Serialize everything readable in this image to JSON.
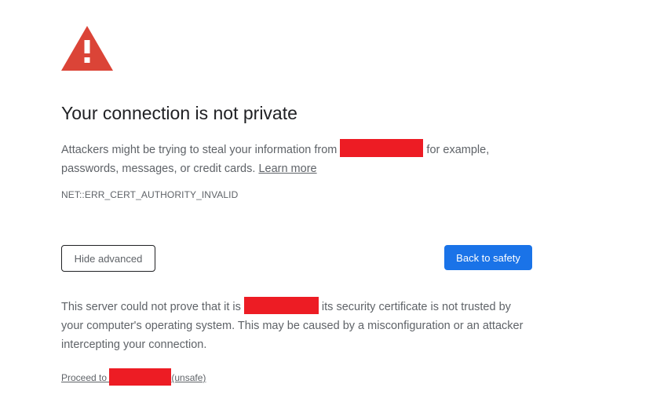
{
  "title": "Your connection is not private",
  "main_message": {
    "before": "Attackers might be trying to steal your information from ",
    "after": " for example, passwords, messages, or credit cards. ",
    "learn_more": "Learn more"
  },
  "error_code": "NET::ERR_CERT_AUTHORITY_INVALID",
  "buttons": {
    "hide_advanced": "Hide advanced",
    "back_to_safety": "Back to safety"
  },
  "details": {
    "before": "This server could not prove that it is ",
    "after": " its security certificate is not trusted by your computer's operating system. This may be caused by a misconfiguration or an attacker intercepting your connection."
  },
  "proceed": {
    "before": "Proceed to ",
    "after": "(unsafe)"
  },
  "icons": {
    "warning": "warning-triangle-icon"
  },
  "colors": {
    "warning_icon": "#db4437",
    "primary_button": "#1a73e8",
    "redaction": "#ed1c24",
    "body_text": "#5f6368",
    "title_text": "#202124"
  }
}
